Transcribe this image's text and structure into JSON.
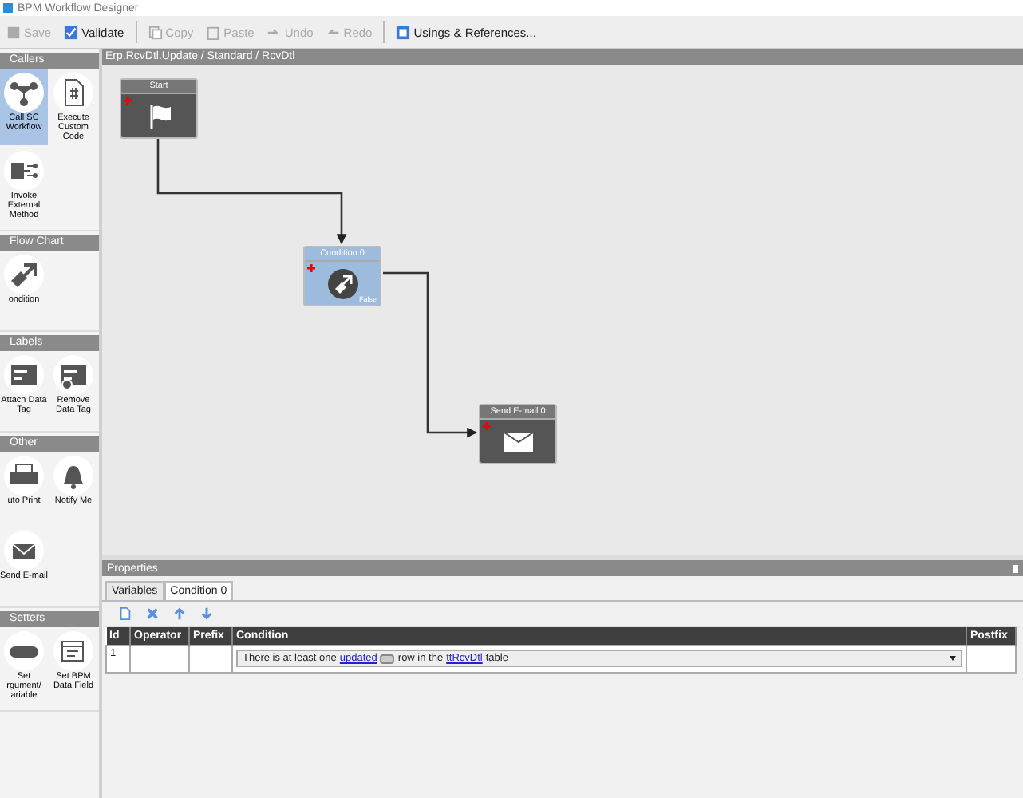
{
  "window": {
    "title": "BPM Workflow Designer"
  },
  "toolbar": [
    {
      "label": "Save",
      "kind": "save",
      "disabled": true
    },
    {
      "label": "Validate",
      "kind": "validate",
      "disabled": false
    },
    {
      "label": "Copy",
      "kind": "copy",
      "disabled": true
    },
    {
      "label": "Paste",
      "kind": "paste",
      "disabled": true
    },
    {
      "label": "Undo",
      "kind": "undo",
      "disabled": true
    },
    {
      "label": "Redo",
      "kind": "redo",
      "disabled": true
    },
    {
      "label": "Usings & References...",
      "kind": "usings",
      "disabled": false
    }
  ],
  "palette": [
    {
      "title": "Callers",
      "items": [
        {
          "label": "Call SC Workflow",
          "kind": "workflow",
          "selected": true
        },
        {
          "label": "Execute Custom Code",
          "kind": "code",
          "selected": false
        },
        {
          "label": "Invoke External Method",
          "kind": "invoke",
          "selected": false
        }
      ]
    },
    {
      "title": "Flow Chart",
      "items": [
        {
          "label": "ondition",
          "kind": "condition",
          "selected": false
        }
      ]
    },
    {
      "title": "Labels",
      "items": [
        {
          "label": "Attach Data Tag",
          "kind": "attach",
          "selected": false
        },
        {
          "label": "Remove Data Tag",
          "kind": "remove",
          "selected": false
        }
      ]
    },
    {
      "title": "Other",
      "items": [
        {
          "label": "uto Print",
          "kind": "print",
          "selected": false
        },
        {
          "label": "Notify Me",
          "kind": "bell",
          "selected": false
        },
        {
          "label": "Send E-mail",
          "kind": "mail",
          "selected": false
        }
      ]
    },
    {
      "title": "Setters",
      "items": [
        {
          "label": "Set rgument/ ariable",
          "kind": "abc",
          "selected": false
        },
        {
          "label": "Set BPM Data Field",
          "kind": "calendar",
          "selected": false
        }
      ]
    }
  ],
  "breadcrumb": "Erp.RcvDtl.Update / Standard / RcvDtl",
  "nodes": [
    {
      "title": "Start",
      "kind": "start",
      "selected": false
    },
    {
      "title": "Condition 0",
      "kind": "condition",
      "selected": true,
      "false_label": "False"
    },
    {
      "title": "Send E-mail 0",
      "kind": "mail",
      "selected": false
    }
  ],
  "properties": {
    "title": "Properties",
    "tabs": [
      {
        "label": "Variables",
        "selected": false
      },
      {
        "label": "Condition 0",
        "selected": true
      }
    ],
    "columns": [
      "Id",
      "Operator",
      "Prefix",
      "Condition",
      "Postfix"
    ],
    "rows": [
      {
        "id": "1",
        "condition": [
          {
            "kind": "text",
            "text": "There is at least one"
          },
          {
            "kind": "link",
            "text": "updated"
          },
          {
            "kind": "dropdown"
          },
          {
            "kind": "text",
            "text": "row in the"
          },
          {
            "kind": "link",
            "text": "ttRcvDtl"
          },
          {
            "kind": "text",
            "text": "table"
          }
        ]
      }
    ]
  }
}
